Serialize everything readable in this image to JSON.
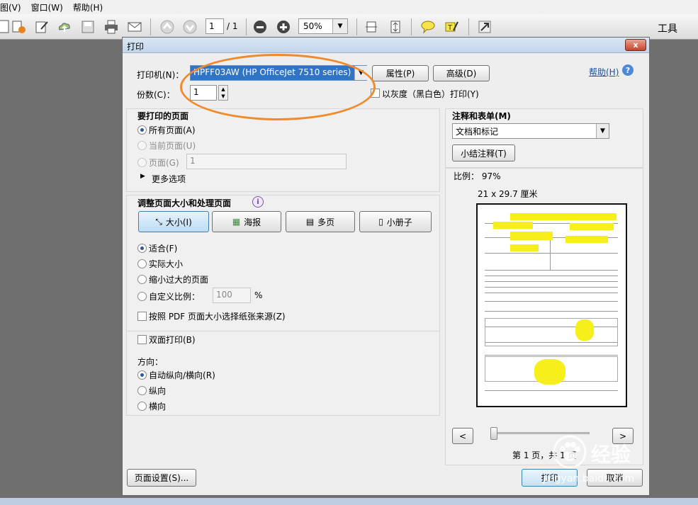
{
  "menubar": {
    "items": [
      "图(V)",
      "窗口(W)",
      "帮助(H)"
    ]
  },
  "toolbar": {
    "page_current": "1",
    "page_total": "/ 1",
    "zoom": "50%",
    "tools_label": "工具",
    "icons": [
      "page-icon",
      "export-icon",
      "edit-icon",
      "upload-icon",
      "save-icon",
      "print-icon",
      "email-icon",
      "prev-page-icon",
      "next-page-icon",
      "zoom-out-icon",
      "zoom-in-icon",
      "fit-page-icon",
      "fit-width-icon",
      "comment-icon",
      "highlight-icon",
      "expand-icon"
    ]
  },
  "dialog": {
    "title": "打印",
    "close": "x",
    "printer_label": "打印机(N)：",
    "printer_value": "HPFF03AW (HP OfficeJet 7510 series)",
    "properties_button": "属性(P)",
    "advanced_button": "高级(D)",
    "help_link": "帮助(H)",
    "copies_label": "份数(C)：",
    "copies_value": "1",
    "grayscale_label": "以灰度（黑白色）打印(Y)",
    "pages_section": {
      "title": "要打印的页面",
      "all_pages": "所有页面(A)",
      "current_page": "当前页面(U)",
      "pages_label": "页面(G)",
      "pages_value": "1",
      "more_options": "更多选项"
    },
    "sizing_section": {
      "title": "调整页面大小和处理页面",
      "size_button": "大小(I)",
      "poster_button": "海报",
      "multiple_button": "多页",
      "booklet_button": "小册子",
      "fit": "适合(F)",
      "actual_size": "实际大小",
      "shrink": "缩小过大的页面",
      "custom_scale": "自定义比例：",
      "custom_scale_value": "100",
      "percent": "%",
      "choose_paper": "按照 PDF 页面大小选择纸张来源(Z)"
    },
    "duplex_label": "双面打印(B)",
    "orientation": {
      "title": "方向：",
      "auto": "自动纵向/横向(R)",
      "portrait": "纵向",
      "landscape": "横向"
    },
    "comments_section": {
      "title": "注释和表单(M)",
      "select_value": "文档和标记",
      "summarize_button": "小结注释(T)"
    },
    "preview": {
      "scale": "比例：  97%",
      "size": "21 x 29.7 厘米",
      "page_info": "第 1 页，共 1 页",
      "prev": "<",
      "next": ">"
    },
    "page_setup_button": "页面设置(S)...",
    "print_button": "打印",
    "cancel_button": "取消"
  },
  "watermark": {
    "text": "经验",
    "url": "jingyan.baidu.com"
  },
  "colors": {
    "annotation": "#f08a2c",
    "selection": "#3074c8",
    "highlight": "#f6ef1a"
  }
}
